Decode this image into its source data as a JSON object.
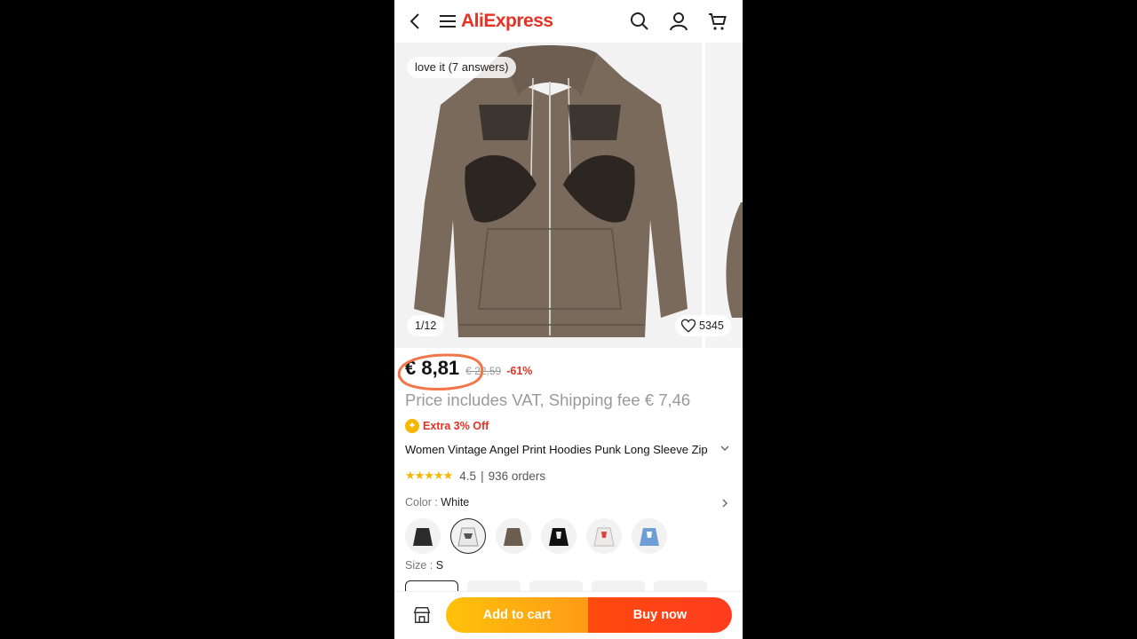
{
  "header": {
    "brand": "AliExpress",
    "icons": [
      "back-arrow-icon",
      "menu-icon",
      "search-icon",
      "account-icon",
      "cart-icon"
    ]
  },
  "gallery": {
    "answers_badge": "love it (7 answers)",
    "counter": "1/12",
    "likes": "5345"
  },
  "price": {
    "current": "€ 8,81",
    "original": "€ 22,59",
    "discount": "-61%",
    "vat_note": "Price includes VAT, Shipping fee € 7,46",
    "extra_off": "Extra 3% Off"
  },
  "product": {
    "title": "Women Vintage Angel Print Hoodies Punk Long Sleeve Zip Up Oversized Sweatshirt",
    "rating": "4.5",
    "orders": "936 orders",
    "color_label": "Color",
    "color_value": "White",
    "size_label": "Size",
    "size_value": "S"
  },
  "swatches": [
    {
      "name": "black",
      "color": "#2b2b2b"
    },
    {
      "name": "white",
      "color": "#e8e8e8"
    },
    {
      "name": "brown",
      "color": "#6b5d50"
    },
    {
      "name": "black-print",
      "color": "#111111"
    },
    {
      "name": "white-red",
      "color": "#f0e9e9"
    },
    {
      "name": "blue",
      "color": "#6d9fd6"
    }
  ],
  "actions": {
    "add_to_cart": "Add to cart",
    "buy_now": "Buy now"
  },
  "colors": {
    "brand_red": "#e43225",
    "accent_orange": "#ff9b17",
    "annotation_orange": "#f2764a"
  }
}
